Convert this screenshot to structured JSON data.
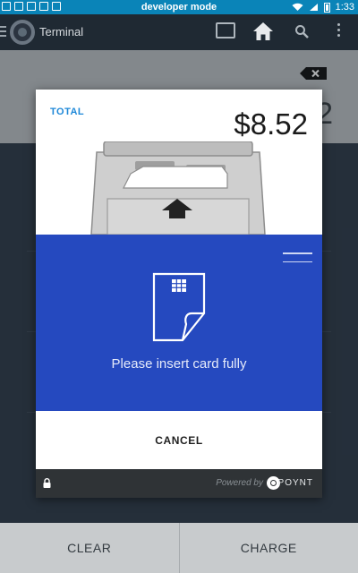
{
  "status_bar": {
    "center_text": "developer mode",
    "time": "1:33",
    "background": "#0a84b8"
  },
  "app_bar": {
    "title": "Terminal",
    "icons": [
      "menu-icon",
      "app-logo",
      "screen-icon",
      "home-icon",
      "search-icon",
      "overflow-icon"
    ]
  },
  "terminal": {
    "amount_partial": "2",
    "clear_label": "CLEAR",
    "charge_label": "CHARGE"
  },
  "modal": {
    "total_label": "TOTAL",
    "total_amount": "$8.52",
    "message": "Please insert card fully",
    "cancel_label": "CANCEL",
    "accent_color": "#2549bf",
    "total_label_color": "#1e88d8",
    "footer": {
      "powered_by": "Powered by",
      "brand": "POYNT"
    }
  }
}
